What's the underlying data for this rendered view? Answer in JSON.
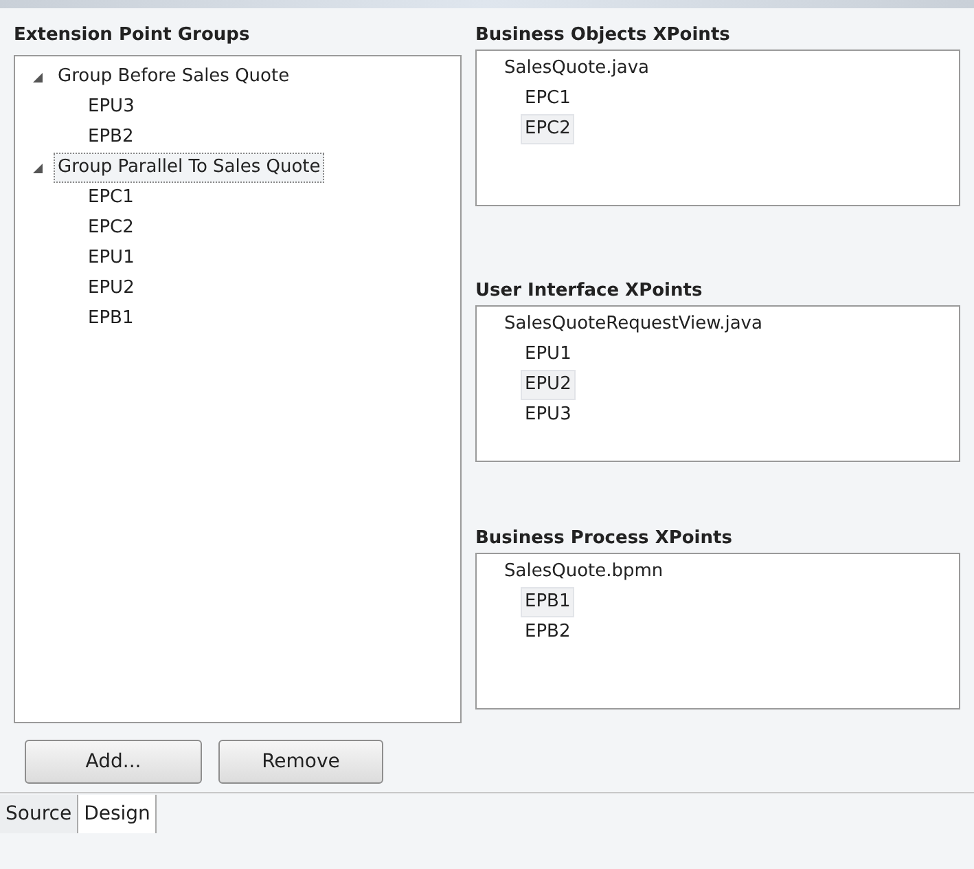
{
  "extension_point_groups": {
    "title": "Extension Point Groups",
    "tree": [
      {
        "label": "Group Before Sales Quote",
        "expanded": true,
        "selected": false,
        "children": [
          {
            "label": "EPU3",
            "selected": false
          },
          {
            "label": "EPB2",
            "selected": false
          }
        ]
      },
      {
        "label": "Group Parallel To Sales Quote",
        "expanded": true,
        "selected": true,
        "children": [
          {
            "label": "EPC1",
            "selected": false
          },
          {
            "label": "EPC2",
            "selected": false
          },
          {
            "label": "EPU1",
            "selected": false
          },
          {
            "label": "EPU2",
            "selected": false
          },
          {
            "label": "EPB1",
            "selected": false
          }
        ]
      }
    ]
  },
  "xpoint_panels": [
    {
      "title": "Business Objects XPoints",
      "root": "SalesQuote.java",
      "items": [
        {
          "label": "EPC1",
          "selected": false
        },
        {
          "label": "EPC2",
          "selected": true
        }
      ]
    },
    {
      "title": "User Interface XPoints",
      "root": "SalesQuoteRequestView.java",
      "items": [
        {
          "label": "EPU1",
          "selected": false
        },
        {
          "label": "EPU2",
          "selected": true
        },
        {
          "label": "EPU3",
          "selected": false
        }
      ]
    },
    {
      "title": "Business Process XPoints",
      "root": "SalesQuote.bpmn",
      "items": [
        {
          "label": "EPB1",
          "selected": true
        },
        {
          "label": "EPB2",
          "selected": false
        }
      ]
    }
  ],
  "buttons": [
    "Add...",
    "Remove"
  ],
  "tabs": [
    {
      "label": "Source",
      "selected": false
    },
    {
      "label": "Design",
      "selected": true
    }
  ]
}
